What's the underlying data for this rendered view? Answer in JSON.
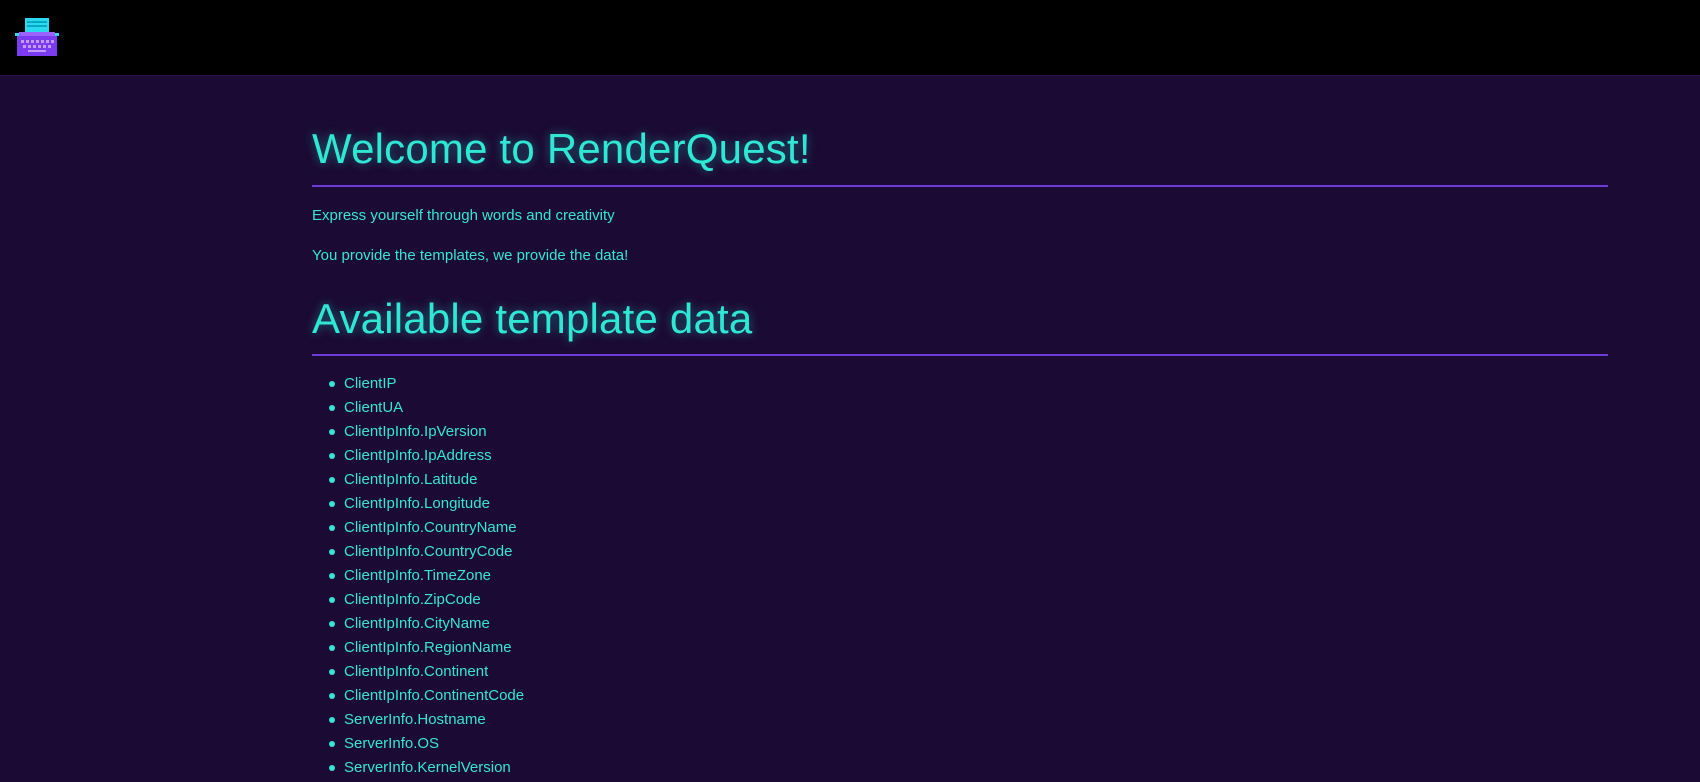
{
  "header": {
    "logo_icon": "typewriter-icon"
  },
  "main": {
    "title": "Welcome to RenderQuest!",
    "tagline": "Express yourself through words and creativity",
    "subtitle": "You provide the templates, we provide the data!",
    "section_title": "Available template data",
    "fields": [
      "ClientIP",
      "ClientUA",
      "ClientIpInfo.IpVersion",
      "ClientIpInfo.IpAddress",
      "ClientIpInfo.Latitude",
      "ClientIpInfo.Longitude",
      "ClientIpInfo.CountryName",
      "ClientIpInfo.CountryCode",
      "ClientIpInfo.TimeZone",
      "ClientIpInfo.ZipCode",
      "ClientIpInfo.CityName",
      "ClientIpInfo.RegionName",
      "ClientIpInfo.Continent",
      "ClientIpInfo.ContinentCode",
      "ServerInfo.Hostname",
      "ServerInfo.OS",
      "ServerInfo.KernelVersion"
    ]
  },
  "colors": {
    "background": "#1b0a33",
    "header_bg": "#000000",
    "accent_text": "#35e6d3",
    "rule": "#6f3bd6",
    "logo_purple": "#7b3cf0",
    "logo_cyan": "#29d9f0"
  }
}
